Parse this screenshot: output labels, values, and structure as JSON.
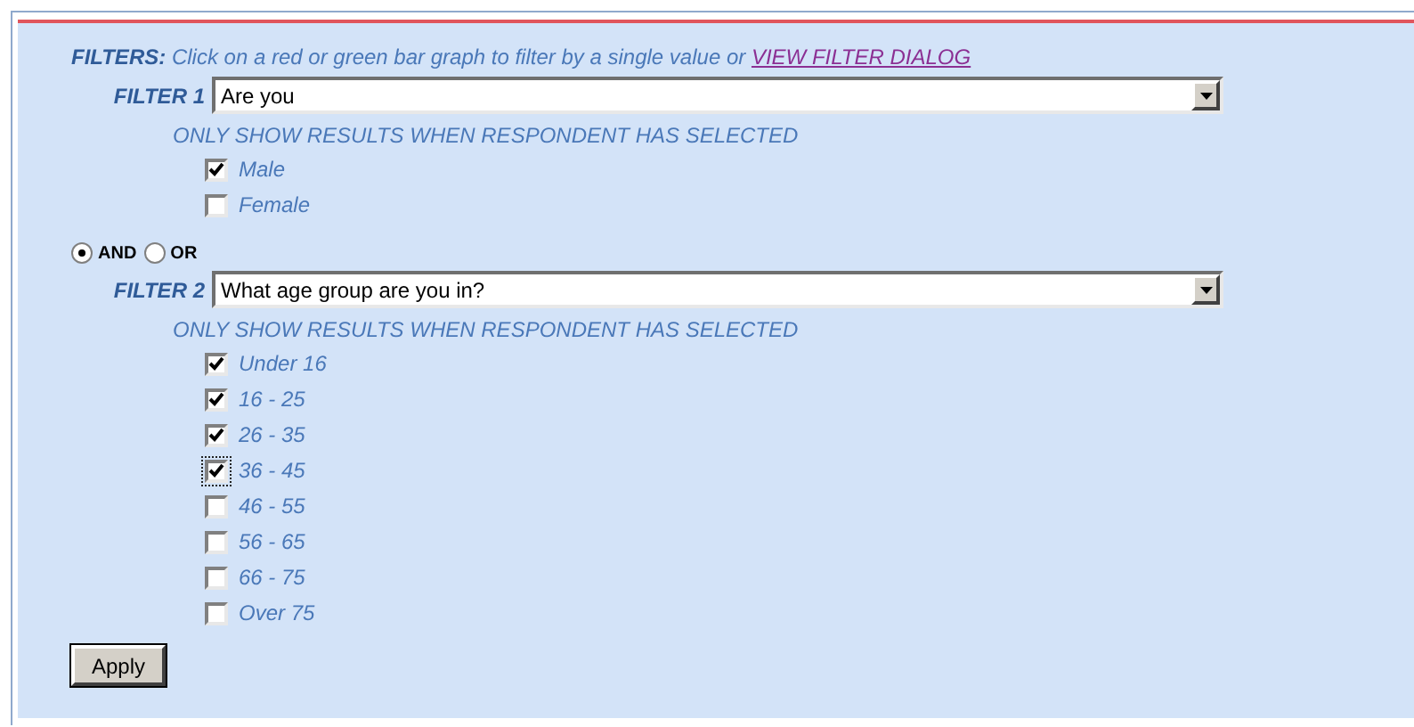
{
  "intro": {
    "heading": "FILTERS:",
    "text": "Click on a red or green bar graph to filter by a single value or",
    "link": "VIEW FILTER DIALOG"
  },
  "filters": [
    {
      "label": "FILTER 1",
      "value": "Are you",
      "subtitle": "ONLY SHOW RESULTS WHEN RESPONDENT HAS SELECTED",
      "options": [
        {
          "label": "Male",
          "checked": true,
          "focused": false
        },
        {
          "label": "Female",
          "checked": false,
          "focused": false
        }
      ]
    },
    {
      "label": "FILTER 2",
      "value": "What age group are you in?",
      "subtitle": "ONLY SHOW RESULTS WHEN RESPONDENT HAS SELECTED",
      "options": [
        {
          "label": "Under 16",
          "checked": true,
          "focused": false
        },
        {
          "label": "16 - 25",
          "checked": true,
          "focused": false
        },
        {
          "label": "26 - 35",
          "checked": true,
          "focused": false
        },
        {
          "label": "36 - 45",
          "checked": true,
          "focused": true
        },
        {
          "label": "46 - 55",
          "checked": false,
          "focused": false
        },
        {
          "label": "56 - 65",
          "checked": false,
          "focused": false
        },
        {
          "label": "66 - 75",
          "checked": false,
          "focused": false
        },
        {
          "label": "Over 75",
          "checked": false,
          "focused": false
        }
      ]
    }
  ],
  "joiners": [
    {
      "label": "AND",
      "selected": true
    },
    {
      "label": "OR",
      "selected": false
    }
  ],
  "apply_button": "Apply"
}
